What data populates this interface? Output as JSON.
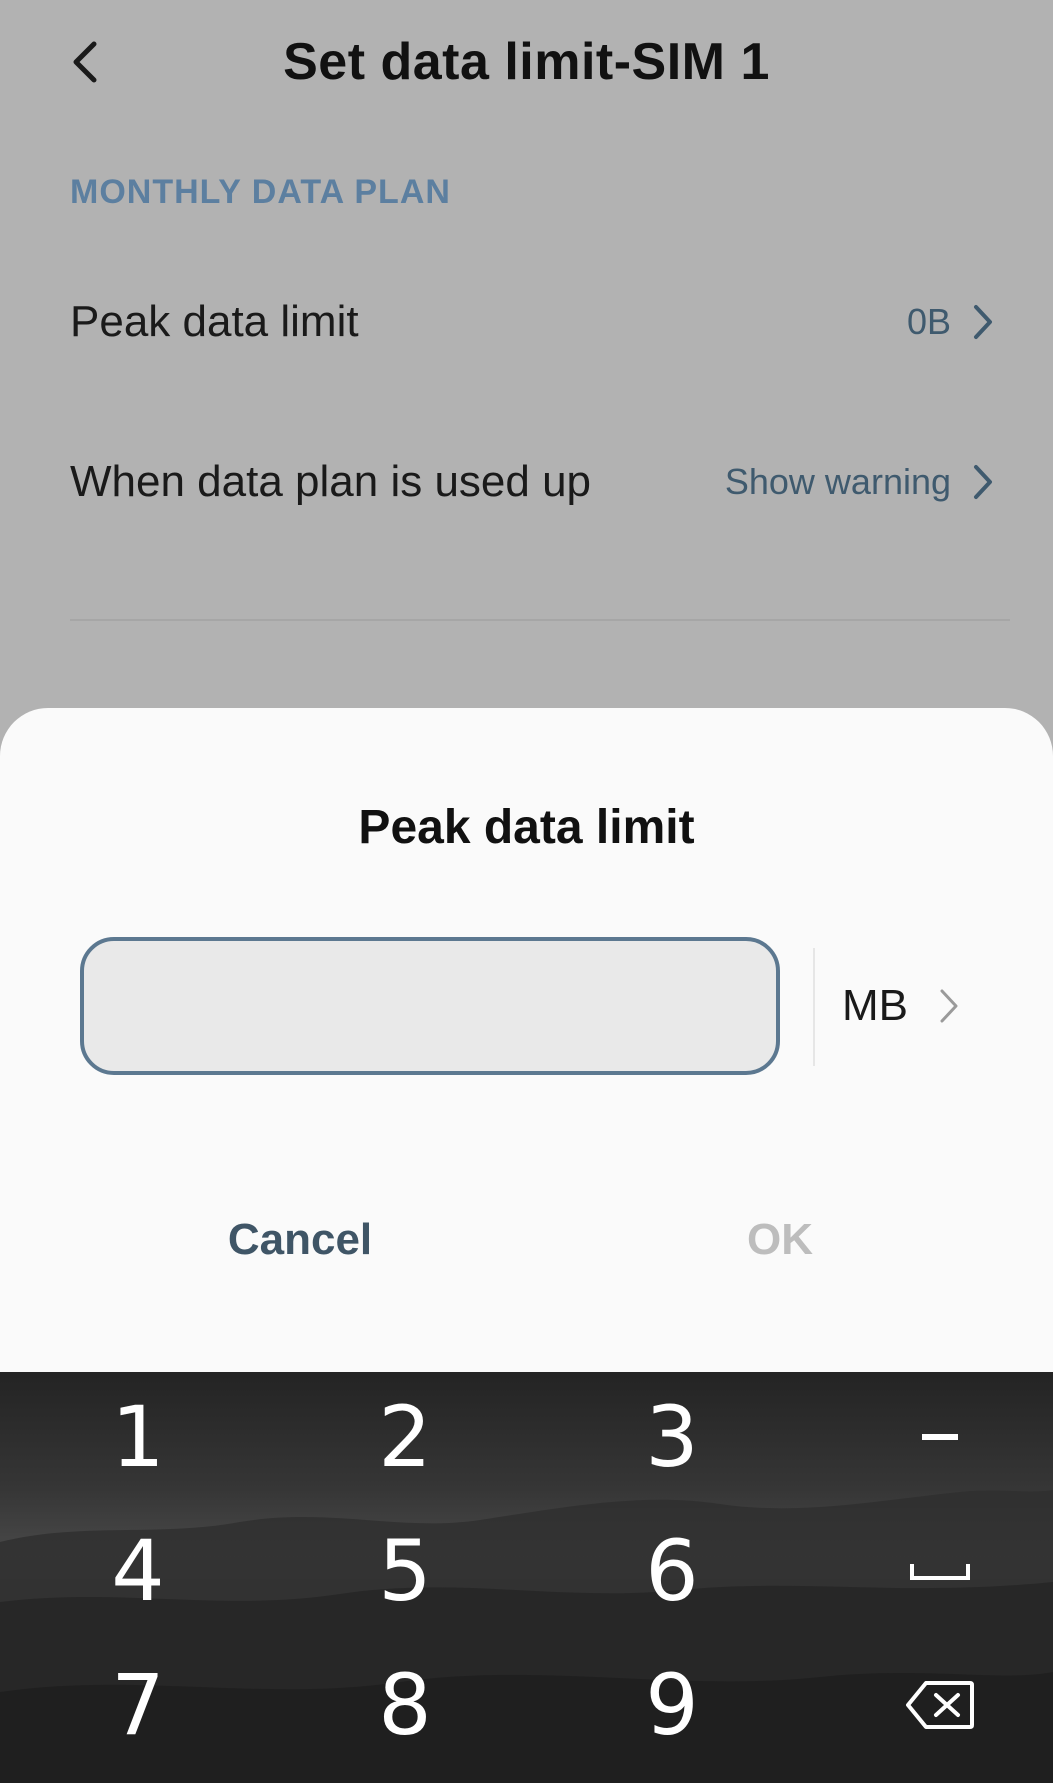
{
  "header": {
    "title": "Set data limit-SIM 1",
    "back_icon": "chevron-left-icon"
  },
  "section": {
    "title": "MONTHLY DATA PLAN"
  },
  "rows": [
    {
      "label": "Peak data limit",
      "value": "0B"
    },
    {
      "label": "When data plan is used up",
      "value": "Show warning"
    }
  ],
  "dialog": {
    "title": "Peak data limit",
    "input_value": "",
    "unit": "MB",
    "cancel_label": "Cancel",
    "ok_label": "OK"
  },
  "keypad": {
    "keys": [
      "1",
      "2",
      "3",
      "4",
      "5",
      "6",
      "7",
      "8",
      "9"
    ],
    "special_keys": [
      "minus-icon",
      "space-icon",
      "backspace-icon"
    ]
  },
  "colors": {
    "accent": "#5c7fa0",
    "value_text": "#3f5a6e",
    "ok_disabled": "#bdbdbd",
    "input_border": "#5c7890"
  }
}
